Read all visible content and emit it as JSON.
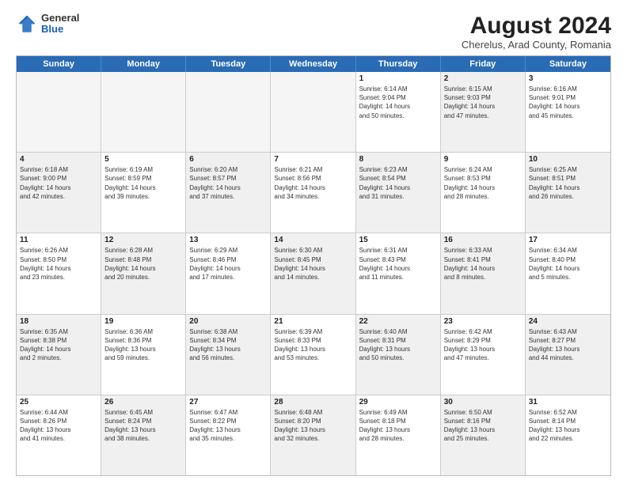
{
  "header": {
    "logo_general": "General",
    "logo_blue": "Blue",
    "month_year": "August 2024",
    "location": "Cherelus, Arad County, Romania"
  },
  "days_of_week": [
    "Sunday",
    "Monday",
    "Tuesday",
    "Wednesday",
    "Thursday",
    "Friday",
    "Saturday"
  ],
  "weeks": [
    [
      {
        "day": "",
        "info": "",
        "shaded": true
      },
      {
        "day": "",
        "info": "",
        "shaded": true
      },
      {
        "day": "",
        "info": "",
        "shaded": true
      },
      {
        "day": "",
        "info": "",
        "shaded": true
      },
      {
        "day": "1",
        "info": "Sunrise: 6:14 AM\nSunset: 9:04 PM\nDaylight: 14 hours\nand 50 minutes.",
        "shaded": false
      },
      {
        "day": "2",
        "info": "Sunrise: 6:15 AM\nSunset: 9:03 PM\nDaylight: 14 hours\nand 47 minutes.",
        "shaded": true
      },
      {
        "day": "3",
        "info": "Sunrise: 6:16 AM\nSunset: 9:01 PM\nDaylight: 14 hours\nand 45 minutes.",
        "shaded": false
      }
    ],
    [
      {
        "day": "4",
        "info": "Sunrise: 6:18 AM\nSunset: 9:00 PM\nDaylight: 14 hours\nand 42 minutes.",
        "shaded": true
      },
      {
        "day": "5",
        "info": "Sunrise: 6:19 AM\nSunset: 8:59 PM\nDaylight: 14 hours\nand 39 minutes.",
        "shaded": false
      },
      {
        "day": "6",
        "info": "Sunrise: 6:20 AM\nSunset: 8:57 PM\nDaylight: 14 hours\nand 37 minutes.",
        "shaded": true
      },
      {
        "day": "7",
        "info": "Sunrise: 6:21 AM\nSunset: 8:56 PM\nDaylight: 14 hours\nand 34 minutes.",
        "shaded": false
      },
      {
        "day": "8",
        "info": "Sunrise: 6:23 AM\nSunset: 8:54 PM\nDaylight: 14 hours\nand 31 minutes.",
        "shaded": true
      },
      {
        "day": "9",
        "info": "Sunrise: 6:24 AM\nSunset: 8:53 PM\nDaylight: 14 hours\nand 28 minutes.",
        "shaded": false
      },
      {
        "day": "10",
        "info": "Sunrise: 6:25 AM\nSunset: 8:51 PM\nDaylight: 14 hours\nand 26 minutes.",
        "shaded": true
      }
    ],
    [
      {
        "day": "11",
        "info": "Sunrise: 6:26 AM\nSunset: 8:50 PM\nDaylight: 14 hours\nand 23 minutes.",
        "shaded": false
      },
      {
        "day": "12",
        "info": "Sunrise: 6:28 AM\nSunset: 8:48 PM\nDaylight: 14 hours\nand 20 minutes.",
        "shaded": true
      },
      {
        "day": "13",
        "info": "Sunrise: 6:29 AM\nSunset: 8:46 PM\nDaylight: 14 hours\nand 17 minutes.",
        "shaded": false
      },
      {
        "day": "14",
        "info": "Sunrise: 6:30 AM\nSunset: 8:45 PM\nDaylight: 14 hours\nand 14 minutes.",
        "shaded": true
      },
      {
        "day": "15",
        "info": "Sunrise: 6:31 AM\nSunset: 8:43 PM\nDaylight: 14 hours\nand 11 minutes.",
        "shaded": false
      },
      {
        "day": "16",
        "info": "Sunrise: 6:33 AM\nSunset: 8:41 PM\nDaylight: 14 hours\nand 8 minutes.",
        "shaded": true
      },
      {
        "day": "17",
        "info": "Sunrise: 6:34 AM\nSunset: 8:40 PM\nDaylight: 14 hours\nand 5 minutes.",
        "shaded": false
      }
    ],
    [
      {
        "day": "18",
        "info": "Sunrise: 6:35 AM\nSunset: 8:38 PM\nDaylight: 14 hours\nand 2 minutes.",
        "shaded": true
      },
      {
        "day": "19",
        "info": "Sunrise: 6:36 AM\nSunset: 8:36 PM\nDaylight: 13 hours\nand 59 minutes.",
        "shaded": false
      },
      {
        "day": "20",
        "info": "Sunrise: 6:38 AM\nSunset: 8:34 PM\nDaylight: 13 hours\nand 56 minutes.",
        "shaded": true
      },
      {
        "day": "21",
        "info": "Sunrise: 6:39 AM\nSunset: 8:33 PM\nDaylight: 13 hours\nand 53 minutes.",
        "shaded": false
      },
      {
        "day": "22",
        "info": "Sunrise: 6:40 AM\nSunset: 8:31 PM\nDaylight: 13 hours\nand 50 minutes.",
        "shaded": true
      },
      {
        "day": "23",
        "info": "Sunrise: 6:42 AM\nSunset: 8:29 PM\nDaylight: 13 hours\nand 47 minutes.",
        "shaded": false
      },
      {
        "day": "24",
        "info": "Sunrise: 6:43 AM\nSunset: 8:27 PM\nDaylight: 13 hours\nand 44 minutes.",
        "shaded": true
      }
    ],
    [
      {
        "day": "25",
        "info": "Sunrise: 6:44 AM\nSunset: 8:26 PM\nDaylight: 13 hours\nand 41 minutes.",
        "shaded": false
      },
      {
        "day": "26",
        "info": "Sunrise: 6:45 AM\nSunset: 8:24 PM\nDaylight: 13 hours\nand 38 minutes.",
        "shaded": true
      },
      {
        "day": "27",
        "info": "Sunrise: 6:47 AM\nSunset: 8:22 PM\nDaylight: 13 hours\nand 35 minutes.",
        "shaded": false
      },
      {
        "day": "28",
        "info": "Sunrise: 6:48 AM\nSunset: 8:20 PM\nDaylight: 13 hours\nand 32 minutes.",
        "shaded": true
      },
      {
        "day": "29",
        "info": "Sunrise: 6:49 AM\nSunset: 8:18 PM\nDaylight: 13 hours\nand 28 minutes.",
        "shaded": false
      },
      {
        "day": "30",
        "info": "Sunrise: 6:50 AM\nSunset: 8:16 PM\nDaylight: 13 hours\nand 25 minutes.",
        "shaded": true
      },
      {
        "day": "31",
        "info": "Sunrise: 6:52 AM\nSunset: 8:14 PM\nDaylight: 13 hours\nand 22 minutes.",
        "shaded": false
      }
    ]
  ]
}
